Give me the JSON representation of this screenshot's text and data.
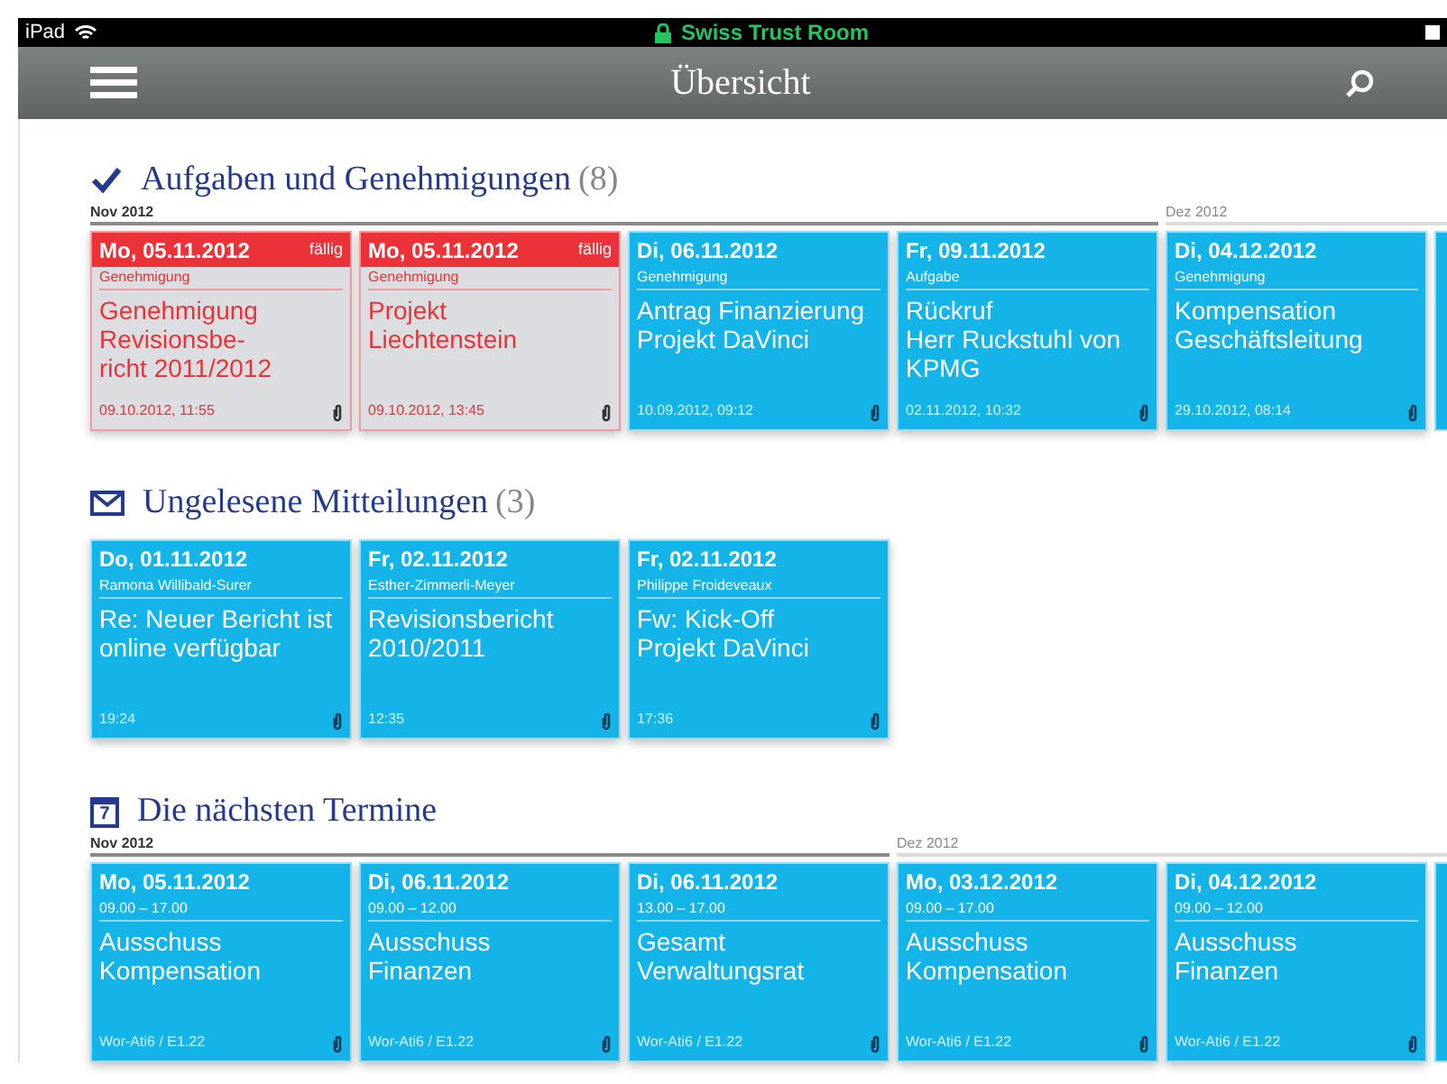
{
  "status_bar": {
    "device": "iPad",
    "title": "Swiss Trust Room"
  },
  "nav_bar": {
    "title": "Übersicht"
  },
  "sections": [
    {
      "kind": "tasks",
      "title": "Aufgaben und Genehmigungen",
      "count": "(8)",
      "months": [
        {
          "label": "Nov 2012",
          "cards": [
            {
              "due": true,
              "date": "Mo, 05.11.2012",
              "badge": "fällig",
              "subtitle": "Genehmigung",
              "title": [
                "Genehmigung",
                "Revisionsbe-",
                "richt 2011/2012"
              ],
              "footer": "09.10.2012, 11:55",
              "attachment": true
            },
            {
              "due": true,
              "date": "Mo, 05.11.2012",
              "badge": "fällig",
              "subtitle": "Genehmigung",
              "title": [
                "Projekt",
                "Liechtenstein"
              ],
              "footer": "09.10.2012, 13:45",
              "attachment": true
            },
            {
              "due": false,
              "date": "Di, 06.11.2012",
              "subtitle": "Genehmigung",
              "title": [
                "Antrag Finanzierung",
                "Projekt DaVinci"
              ],
              "footer": "10.09.2012, 09:12",
              "attachment": true
            },
            {
              "due": false,
              "date": "Fr, 09.11.2012",
              "subtitle": "Aufgabe",
              "title": [
                "Rückruf",
                "Herr Ruckstuhl von",
                "KPMG"
              ],
              "footer": "02.11.2012, 10:32",
              "attachment": true
            }
          ]
        },
        {
          "label": "Dez 2012",
          "cards": [
            {
              "due": false,
              "date": "Di, 04.12.2012",
              "subtitle": "Genehmigung",
              "title": [
                "Kompensation",
                "Geschäftsleitung"
              ],
              "footer": "29.10.2012, 08:14",
              "attachment": true
            }
          ],
          "cut_off_card": true
        }
      ]
    },
    {
      "kind": "messages",
      "title": "Ungelesene Mitteilungen",
      "count": "(3)",
      "months": [
        {
          "cards": [
            {
              "due": false,
              "date": "Do, 01.11.2012",
              "subtitle": "Ramona Willibald-Surer",
              "title": [
                "Re: Neuer Bericht ist",
                "online verfügbar"
              ],
              "footer": "19:24",
              "attachment": true
            },
            {
              "due": false,
              "date": "Fr, 02.11.2012",
              "subtitle": "Esther-Zimmerli-Meyer",
              "title": [
                "Revisionsbericht",
                "2010/2011"
              ],
              "footer": "12:35",
              "attachment": true
            },
            {
              "due": false,
              "date": "Fr, 02.11.2012",
              "subtitle": "Philippe Froideveaux",
              "title": [
                "Fw: Kick-Off",
                "Projekt DaVinci"
              ],
              "footer": "17:36",
              "attachment": true
            }
          ]
        }
      ]
    },
    {
      "kind": "calendar",
      "icon_label": "7",
      "title": "Die nächsten Termine",
      "months": [
        {
          "label": "Nov 2012",
          "cards": [
            {
              "due": false,
              "date": "Mo, 05.11.2012",
              "subtitle": "09.00 – 17.00",
              "title": [
                "Ausschuss",
                "Kompensation"
              ],
              "footer": "Wor-Ati6 / E1.22",
              "attachment": true
            },
            {
              "due": false,
              "date": "Di, 06.11.2012",
              "subtitle": "09.00 – 12.00",
              "title": [
                "Ausschuss",
                "Finanzen"
              ],
              "footer": "Wor-Ati6 / E1.22",
              "attachment": true
            },
            {
              "due": false,
              "date": "Di, 06.11.2012",
              "subtitle": "13.00 – 17.00",
              "title": [
                "Gesamt",
                "Verwaltungsrat"
              ],
              "footer": "Wor-Ati6 / E1.22",
              "attachment": true
            }
          ]
        },
        {
          "label": "Dez 2012",
          "cards": [
            {
              "due": false,
              "date": "Mo, 03.12.2012",
              "subtitle": "09.00 – 17.00",
              "title": [
                "Ausschuss",
                "Kompensation"
              ],
              "footer": "Wor-Ati6 / E1.22",
              "attachment": true
            },
            {
              "due": false,
              "date": "Di, 04.12.2012",
              "subtitle": "09.00 – 12.00",
              "title": [
                "Ausschuss",
                "Finanzen"
              ],
              "footer": "Wor-Ati6 / E1.22",
              "attachment": true
            }
          ],
          "cut_off_card": true
        }
      ]
    }
  ]
}
